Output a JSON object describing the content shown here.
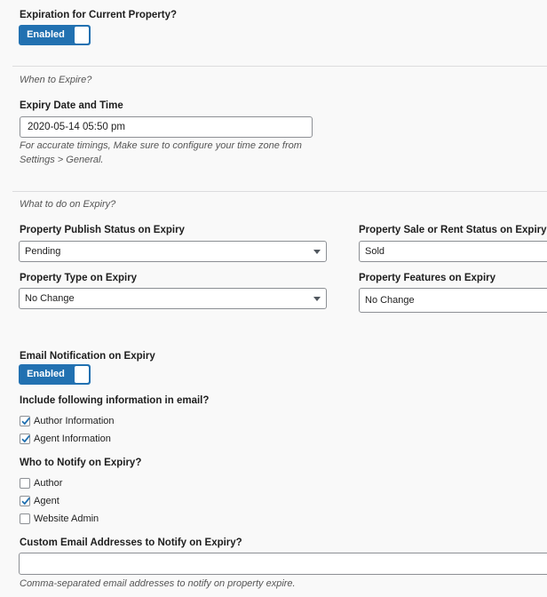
{
  "expiration": {
    "label": "Expiration for Current Property?",
    "toggle_label": "Enabled"
  },
  "when_section": "When to Expire?",
  "expiry_date": {
    "label": "Expiry Date and Time",
    "value": "2020-05-14 05:50 pm",
    "help_line1": "For accurate timings, Make sure to configure your time zone from",
    "help_line2": "Settings > General."
  },
  "what_section": "What to do on Expiry?",
  "publish_status": {
    "label": "Property Publish Status on Expiry",
    "value": "Pending"
  },
  "sale_status": {
    "label": "Property Sale or Rent Status on Expiry",
    "value": "Sold"
  },
  "property_type": {
    "label": "Property Type on Expiry",
    "value": "No Change"
  },
  "property_features": {
    "label": "Property Features on Expiry",
    "value": "No Change"
  },
  "email_notification": {
    "label": "Email Notification on Expiry",
    "toggle_label": "Enabled"
  },
  "include_info": {
    "label": "Include following information in email?",
    "options": [
      {
        "label": "Author Information",
        "checked": true
      },
      {
        "label": "Agent Information",
        "checked": true
      }
    ]
  },
  "notify": {
    "label": "Who to Notify on Expiry?",
    "options": [
      {
        "label": "Author",
        "checked": false
      },
      {
        "label": "Agent",
        "checked": true
      },
      {
        "label": "Website Admin",
        "checked": false
      }
    ]
  },
  "custom_emails": {
    "label": "Custom Email Addresses to Notify on Expiry?",
    "value": "",
    "help": "Comma-separated email addresses to notify on property expire."
  },
  "colors": {
    "accent": "#2271b1",
    "check": "#2271b1"
  }
}
